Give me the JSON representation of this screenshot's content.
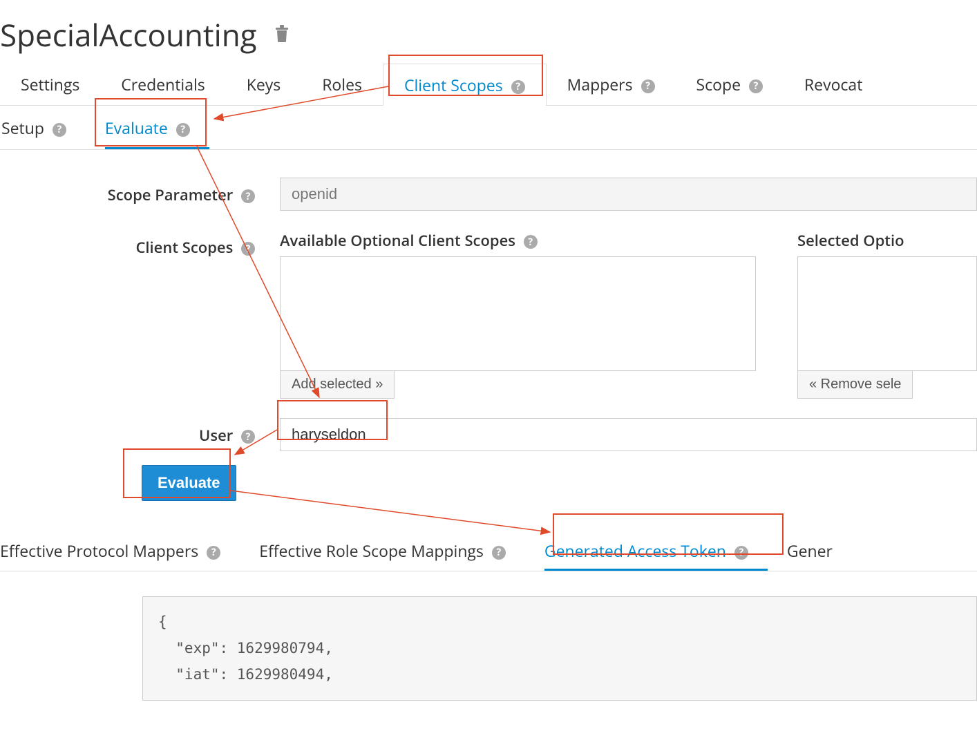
{
  "page_title": "SpecialAccounting",
  "icons": {
    "trash": "🗑",
    "help": "?"
  },
  "tabs": {
    "settings": "Settings",
    "credentials": "Credentials",
    "keys": "Keys",
    "roles": "Roles",
    "client_scopes": "Client Scopes",
    "mappers": "Mappers",
    "scope": "Scope",
    "revocation": "Revocat"
  },
  "subtabs": {
    "setup": "Setup",
    "evaluate": "Evaluate"
  },
  "form": {
    "scope_param_label": "Scope Parameter",
    "scope_param_value": "openid",
    "client_scopes_label": "Client Scopes",
    "available_label": "Available Optional Client Scopes",
    "selected_label": "Selected Optio",
    "add_selected_btn": "Add selected »",
    "remove_selected_btn": "« Remove sele",
    "user_label": "User",
    "user_value": "haryseldon",
    "evaluate_btn": "Evaluate"
  },
  "bottom_tabs": {
    "effective_mappers": "Effective Protocol Mappers",
    "effective_role": "Effective Role Scope Mappings",
    "generated_token": "Generated Access Token",
    "gener": "Gener"
  },
  "token": {
    "line1": "{",
    "line2": "  \"exp\": 1629980794,",
    "line3": "  \"iat\": 1629980494,"
  }
}
